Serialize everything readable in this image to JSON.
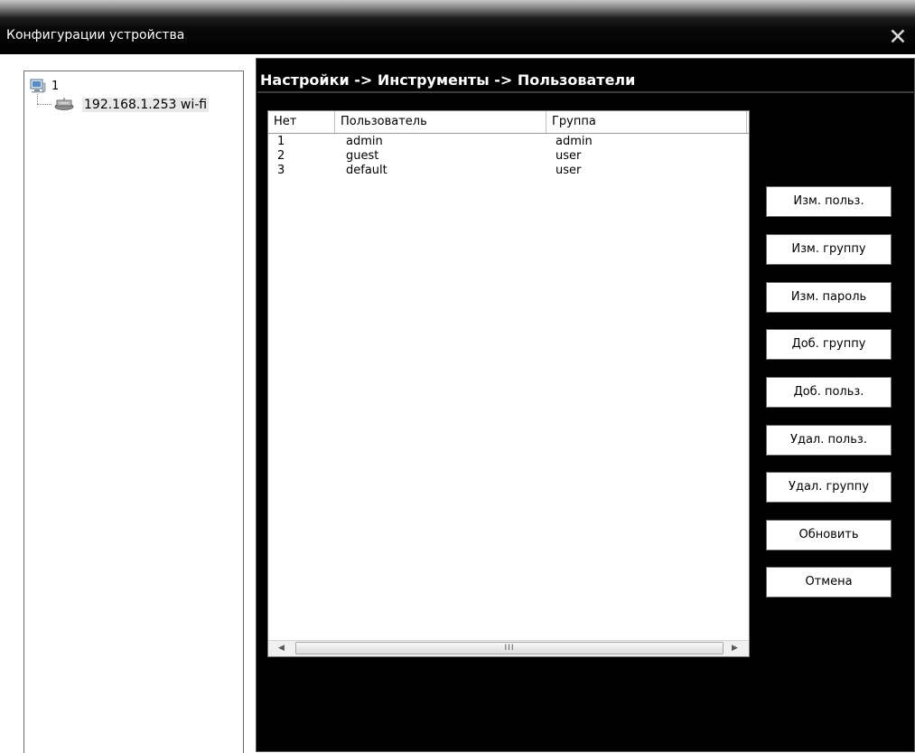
{
  "window": {
    "title": "Конфигурации устройства",
    "close_glyph": "✕"
  },
  "tree": {
    "root_label": "1",
    "root_icon": "computer-icon",
    "child_label": "192.168.1.253 wi-fi",
    "child_icon": "network-device-icon"
  },
  "breadcrumb": "Настройки -> Инструменты -> Пользователи",
  "users_table": {
    "headers": [
      "Нет",
      "Пользователь",
      "Группа"
    ],
    "rows": [
      {
        "no": "1",
        "user": "admin",
        "group": "admin"
      },
      {
        "no": "2",
        "user": "guest",
        "group": "user"
      },
      {
        "no": "3",
        "user": "default",
        "group": "user"
      }
    ],
    "scroll_grip": "III"
  },
  "buttons": [
    "Изм. польз.",
    "Изм. группу",
    "Изм. пароль",
    "Доб. группу",
    "Доб. польз.",
    "Удал. польз.",
    "Удал. группу",
    "Обновить",
    "Отмена"
  ],
  "colors": {
    "background": "#000000",
    "panel": "#ffffff",
    "text_light": "#ffffff"
  }
}
